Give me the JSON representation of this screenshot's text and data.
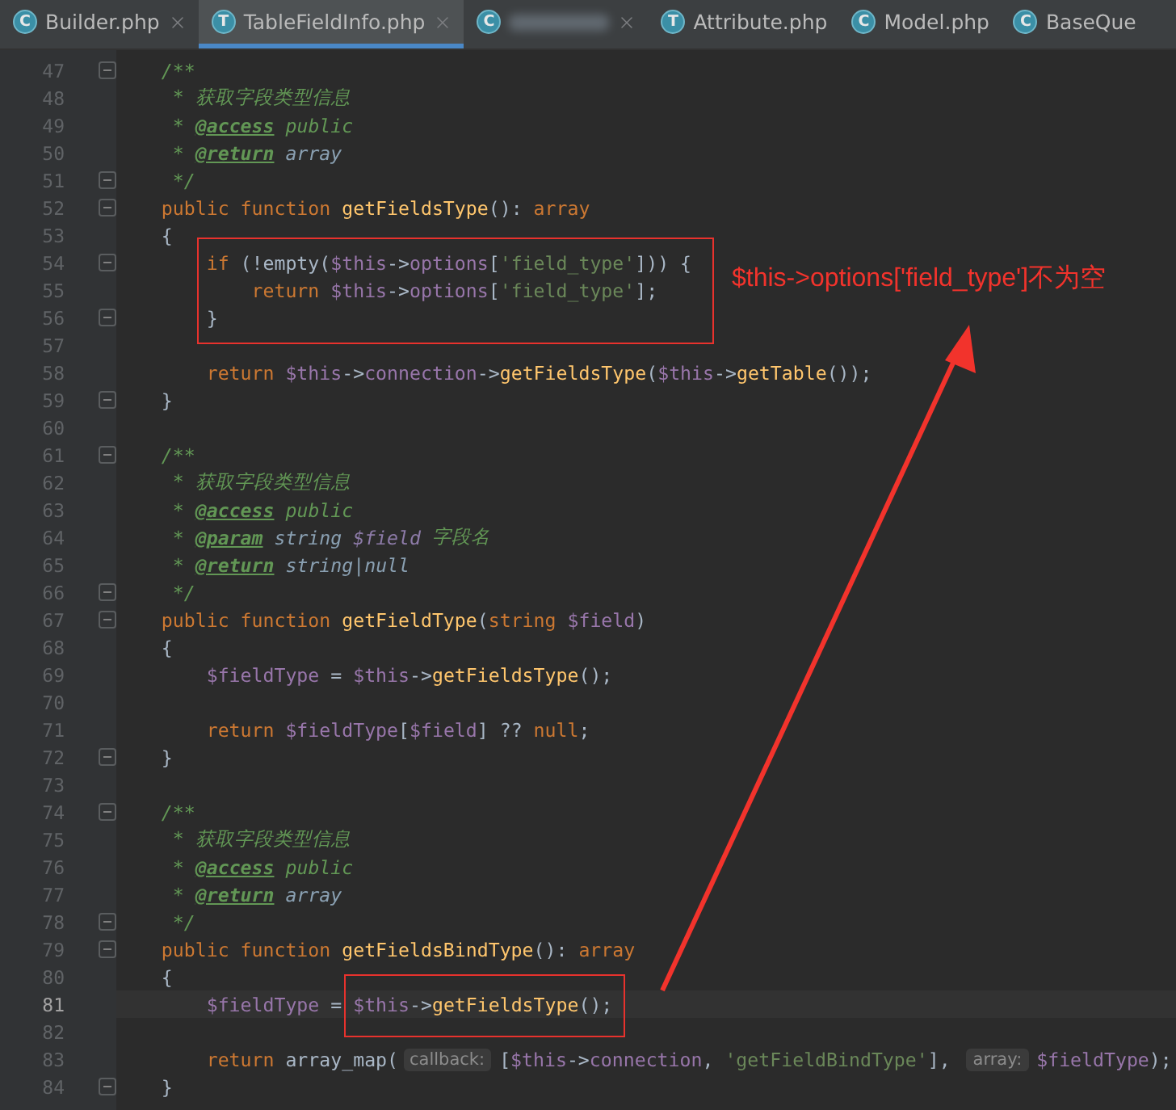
{
  "tabs": [
    {
      "icon_letter": "C",
      "label": "Builder.php",
      "selected": false,
      "close": true
    },
    {
      "icon_letter": "T",
      "label": "TableFieldInfo.php",
      "selected": true,
      "close": true
    },
    {
      "icon_letter": "C",
      "blurred": true,
      "selected": false,
      "close": true
    },
    {
      "icon_letter": "T",
      "label": "Attribute.php",
      "selected": false,
      "close": false
    },
    {
      "icon_letter": "C",
      "label": "Model.php",
      "selected": false,
      "close": false
    },
    {
      "icon_letter": "C",
      "label": "BaseQue",
      "selected": false,
      "close": false
    }
  ],
  "lines": [
    {
      "number": "47",
      "fold": true,
      "current": false,
      "tokens": [
        {
          "kind": "doc",
          "text": "    /**"
        }
      ]
    },
    {
      "number": "48",
      "fold": false,
      "current": false,
      "tokens": [
        {
          "kind": "doc",
          "text": "     * 获取字段类型信息"
        }
      ]
    },
    {
      "number": "49",
      "fold": false,
      "current": false,
      "tokens": [
        {
          "kind": "doc",
          "text": "     * "
        },
        {
          "kind": "doctag",
          "text": "@access"
        },
        {
          "kind": "doc",
          "text": " public"
        }
      ]
    },
    {
      "number": "50",
      "fold": false,
      "current": false,
      "tokens": [
        {
          "kind": "doc",
          "text": "     * "
        },
        {
          "kind": "doctag",
          "text": "@return"
        },
        {
          "kind": "doctype",
          "text": " array"
        }
      ]
    },
    {
      "number": "51",
      "fold": true,
      "current": false,
      "tokens": [
        {
          "kind": "doc",
          "text": "     */"
        }
      ]
    },
    {
      "number": "52",
      "fold": true,
      "current": false,
      "tokens": [
        {
          "kind": "keyword",
          "text": "    public function "
        },
        {
          "kind": "function",
          "text": "getFieldsType"
        },
        {
          "kind": "plain",
          "text": "(): "
        },
        {
          "kind": "keyword",
          "text": "array"
        }
      ]
    },
    {
      "number": "53",
      "fold": false,
      "current": false,
      "tokens": [
        {
          "kind": "plain",
          "text": "    {"
        }
      ]
    },
    {
      "number": "54",
      "fold": true,
      "current": false,
      "tokens": [
        {
          "kind": "keyword",
          "text": "        if "
        },
        {
          "kind": "plain",
          "text": "(!empty("
        },
        {
          "kind": "variable",
          "text": "$this"
        },
        {
          "kind": "plain",
          "text": "->"
        },
        {
          "kind": "field",
          "text": "options"
        },
        {
          "kind": "plain",
          "text": "["
        },
        {
          "kind": "string",
          "text": "'field_type'"
        },
        {
          "kind": "plain",
          "text": "])) {"
        }
      ]
    },
    {
      "number": "55",
      "fold": false,
      "current": false,
      "tokens": [
        {
          "kind": "keyword",
          "text": "            return "
        },
        {
          "kind": "variable",
          "text": "$this"
        },
        {
          "kind": "plain",
          "text": "->"
        },
        {
          "kind": "field",
          "text": "options"
        },
        {
          "kind": "plain",
          "text": "["
        },
        {
          "kind": "string",
          "text": "'field_type'"
        },
        {
          "kind": "plain",
          "text": "];"
        }
      ]
    },
    {
      "number": "56",
      "fold": true,
      "current": false,
      "tokens": [
        {
          "kind": "plain",
          "text": "        }"
        }
      ]
    },
    {
      "number": "57",
      "fold": false,
      "current": false
    },
    {
      "number": "58",
      "fold": false,
      "current": false,
      "tokens": [
        {
          "kind": "keyword",
          "text": "        return "
        },
        {
          "kind": "variable",
          "text": "$this"
        },
        {
          "kind": "plain",
          "text": "->"
        },
        {
          "kind": "field",
          "text": "connection"
        },
        {
          "kind": "plain",
          "text": "->"
        },
        {
          "kind": "function",
          "text": "getFieldsType"
        },
        {
          "kind": "plain",
          "text": "("
        },
        {
          "kind": "variable",
          "text": "$this"
        },
        {
          "kind": "plain",
          "text": "->"
        },
        {
          "kind": "function",
          "text": "getTable"
        },
        {
          "kind": "plain",
          "text": "());"
        }
      ]
    },
    {
      "number": "59",
      "fold": true,
      "current": false,
      "tokens": [
        {
          "kind": "plain",
          "text": "    }"
        }
      ]
    },
    {
      "number": "60",
      "fold": false,
      "current": false
    },
    {
      "number": "61",
      "fold": true,
      "current": false,
      "tokens": [
        {
          "kind": "doc",
          "text": "    /**"
        }
      ]
    },
    {
      "number": "62",
      "fold": false,
      "current": false,
      "tokens": [
        {
          "kind": "doc",
          "text": "     * 获取字段类型信息"
        }
      ]
    },
    {
      "number": "63",
      "fold": false,
      "current": false,
      "tokens": [
        {
          "kind": "doc",
          "text": "     * "
        },
        {
          "kind": "doctag",
          "text": "@access"
        },
        {
          "kind": "doc",
          "text": " public"
        }
      ]
    },
    {
      "number": "64",
      "fold": false,
      "current": false,
      "tokens": [
        {
          "kind": "doc",
          "text": "     * "
        },
        {
          "kind": "doctag",
          "text": "@param"
        },
        {
          "kind": "doctype",
          "text": " string "
        },
        {
          "kind": "docvar",
          "text": "$field"
        },
        {
          "kind": "doc",
          "text": " 字段名"
        }
      ]
    },
    {
      "number": "65",
      "fold": false,
      "current": false,
      "tokens": [
        {
          "kind": "doc",
          "text": "     * "
        },
        {
          "kind": "doctag",
          "text": "@return"
        },
        {
          "kind": "doctype",
          "text": " string|null"
        }
      ]
    },
    {
      "number": "66",
      "fold": true,
      "current": false,
      "tokens": [
        {
          "kind": "doc",
          "text": "     */"
        }
      ]
    },
    {
      "number": "67",
      "fold": true,
      "current": false,
      "tokens": [
        {
          "kind": "keyword",
          "text": "    public function "
        },
        {
          "kind": "function",
          "text": "getFieldType"
        },
        {
          "kind": "plain",
          "text": "("
        },
        {
          "kind": "keyword",
          "text": "string "
        },
        {
          "kind": "variable",
          "text": "$field"
        },
        {
          "kind": "plain",
          "text": ")"
        }
      ]
    },
    {
      "number": "68",
      "fold": false,
      "current": false,
      "tokens": [
        {
          "kind": "plain",
          "text": "    {"
        }
      ]
    },
    {
      "number": "69",
      "fold": false,
      "current": false,
      "tokens": [
        {
          "kind": "variable",
          "text": "        $fieldType"
        },
        {
          "kind": "plain",
          "text": " = "
        },
        {
          "kind": "variable",
          "text": "$this"
        },
        {
          "kind": "plain",
          "text": "->"
        },
        {
          "kind": "function",
          "text": "getFieldsType"
        },
        {
          "kind": "plain",
          "text": "();"
        }
      ]
    },
    {
      "number": "70",
      "fold": false,
      "current": false
    },
    {
      "number": "71",
      "fold": false,
      "current": false,
      "tokens": [
        {
          "kind": "keyword",
          "text": "        return "
        },
        {
          "kind": "variable",
          "text": "$fieldType"
        },
        {
          "kind": "plain",
          "text": "["
        },
        {
          "kind": "variable",
          "text": "$field"
        },
        {
          "kind": "plain",
          "text": "] ?? "
        },
        {
          "kind": "keyword",
          "text": "null"
        },
        {
          "kind": "plain",
          "text": ";"
        }
      ]
    },
    {
      "number": "72",
      "fold": true,
      "current": false,
      "tokens": [
        {
          "kind": "plain",
          "text": "    }"
        }
      ]
    },
    {
      "number": "73",
      "fold": false,
      "current": false
    },
    {
      "number": "74",
      "fold": true,
      "current": false,
      "tokens": [
        {
          "kind": "doc",
          "text": "    /**"
        }
      ]
    },
    {
      "number": "75",
      "fold": false,
      "current": false,
      "tokens": [
        {
          "kind": "doc",
          "text": "     * 获取字段类型信息"
        }
      ]
    },
    {
      "number": "76",
      "fold": false,
      "current": false,
      "tokens": [
        {
          "kind": "doc",
          "text": "     * "
        },
        {
          "kind": "doctag",
          "text": "@access"
        },
        {
          "kind": "doc",
          "text": " public"
        }
      ]
    },
    {
      "number": "77",
      "fold": false,
      "current": false,
      "tokens": [
        {
          "kind": "doc",
          "text": "     * "
        },
        {
          "kind": "doctag",
          "text": "@return"
        },
        {
          "kind": "doctype",
          "text": " array"
        }
      ]
    },
    {
      "number": "78",
      "fold": true,
      "current": false,
      "tokens": [
        {
          "kind": "doc",
          "text": "     */"
        }
      ]
    },
    {
      "number": "79",
      "fold": true,
      "current": false,
      "tokens": [
        {
          "kind": "keyword",
          "text": "    public function "
        },
        {
          "kind": "function",
          "text": "getFieldsBindType"
        },
        {
          "kind": "plain",
          "text": "(): "
        },
        {
          "kind": "keyword",
          "text": "array"
        }
      ]
    },
    {
      "number": "80",
      "fold": false,
      "current": false,
      "tokens": [
        {
          "kind": "plain",
          "text": "    {"
        }
      ]
    },
    {
      "number": "81",
      "fold": false,
      "current": true,
      "tokens": [
        {
          "kind": "variable",
          "text": "        $fieldType"
        },
        {
          "kind": "plain",
          "text": " = "
        },
        {
          "kind": "variable",
          "text": "$this"
        },
        {
          "kind": "plain",
          "text": "->"
        },
        {
          "kind": "function",
          "text": "getFieldsType"
        },
        {
          "kind": "plain",
          "text": "();"
        }
      ]
    },
    {
      "number": "82",
      "fold": false,
      "current": false
    },
    {
      "number": "83",
      "fold": false,
      "current": false,
      "tokens": [
        {
          "kind": "keyword",
          "text": "        return "
        },
        {
          "kind": "plain",
          "text": "array_map("
        },
        {
          "kind": "hint",
          "text": "callback:"
        },
        {
          "kind": "plain",
          "text": "["
        },
        {
          "kind": "variable",
          "text": "$this"
        },
        {
          "kind": "plain",
          "text": "->"
        },
        {
          "kind": "field",
          "text": "connection"
        },
        {
          "kind": "plain",
          "text": ", "
        },
        {
          "kind": "string",
          "text": "'getFieldBindType'"
        },
        {
          "kind": "plain",
          "text": "], "
        },
        {
          "kind": "hint",
          "text": "array:"
        },
        {
          "kind": "variable",
          "text": "$fieldType"
        },
        {
          "kind": "plain",
          "text": ");"
        }
      ]
    },
    {
      "number": "84",
      "fold": true,
      "current": false,
      "tokens": [
        {
          "kind": "plain",
          "text": "    }"
        }
      ]
    }
  ],
  "annotation": {
    "text": "$this->options['field_type']不为空"
  }
}
